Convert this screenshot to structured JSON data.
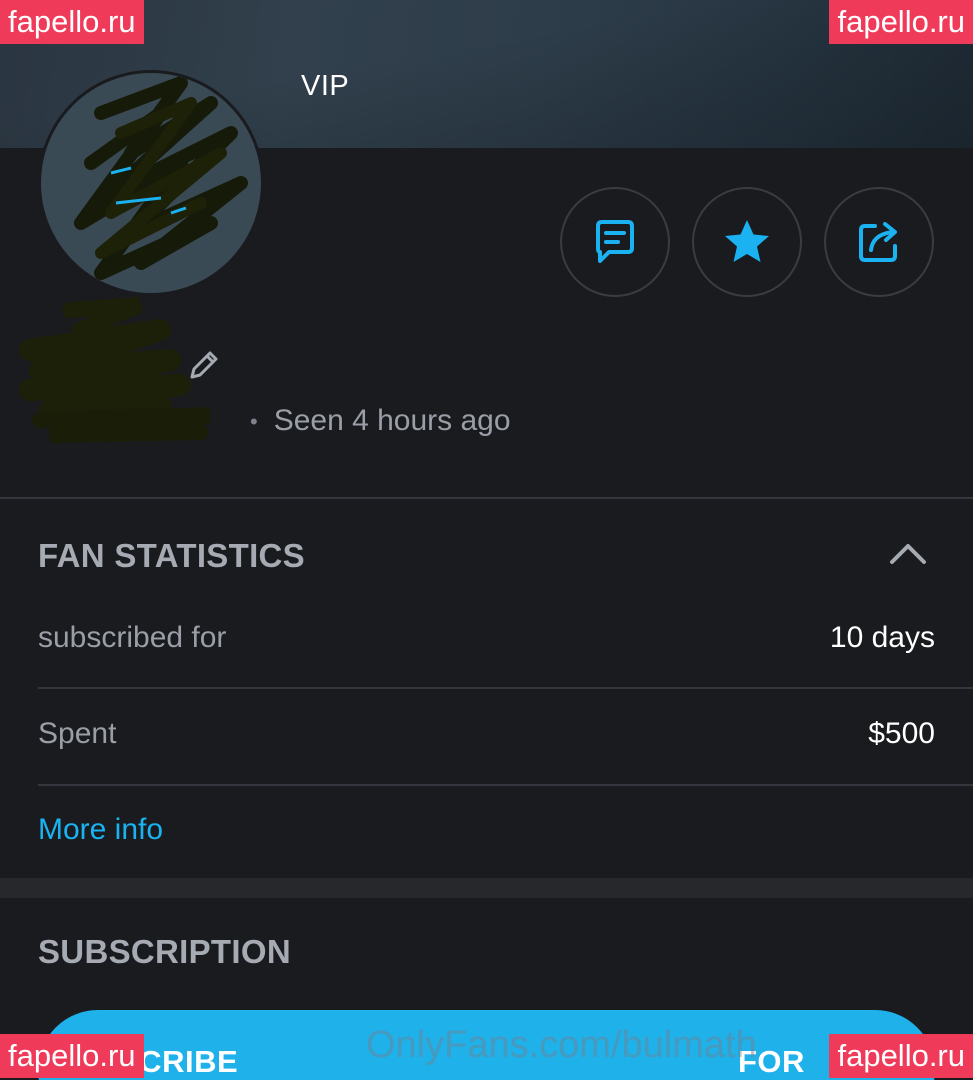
{
  "header": {
    "badge_label": "VIP"
  },
  "actions": {
    "message_icon": "message-icon",
    "favorite_icon": "star-icon",
    "share_icon": "share-icon"
  },
  "profile": {
    "seen_status": "Seen  4 hours ago",
    "dot": "•"
  },
  "fan_statistics": {
    "title": "FAN STATISTICS",
    "rows": [
      {
        "label": "subscribed for",
        "value": "10 days"
      },
      {
        "label": "Spent",
        "value": "$500"
      }
    ],
    "more_info": "More info"
  },
  "subscription": {
    "title": "SUBSCRIPTION",
    "subscribe_label": "SCRIBE",
    "price_label": "FOR"
  },
  "watermarks": {
    "site_badge": "fapello.ru",
    "overlay_text": "OnlyFans.com/bulmath"
  },
  "colors": {
    "accent": "#1ab2f0",
    "background": "#1a1b1f",
    "watermark_badge": "#f03a5a"
  }
}
